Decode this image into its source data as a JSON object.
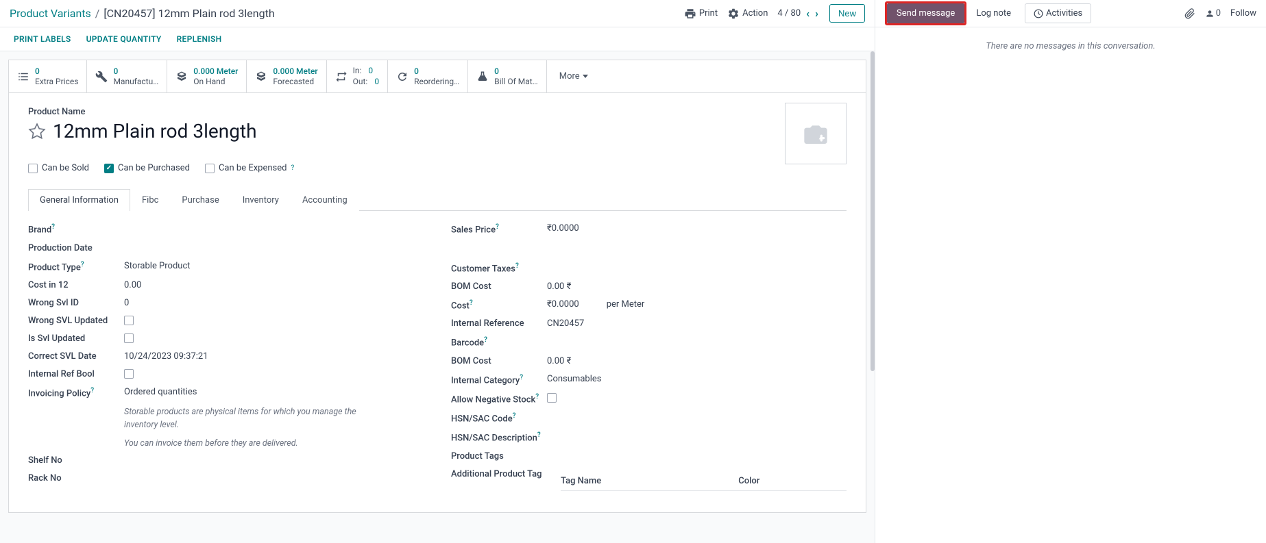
{
  "breadcrumb": {
    "root": "Product Variants",
    "current": "[CN20457] 12mm Plain rod 3length"
  },
  "topbar": {
    "print": "Print",
    "action": "Action",
    "pager": "4 / 80",
    "new": "New"
  },
  "subbar": {
    "print_labels": "PRINT LABELS",
    "update_qty": "UPDATE QUANTITY",
    "replenish": "REPLENISH"
  },
  "stats": {
    "extra_prices": {
      "val": "0",
      "lbl": "Extra Prices"
    },
    "manufacturing": {
      "val": "0",
      "lbl": "Manufactu…"
    },
    "on_hand": {
      "val": "0.000 Meter",
      "lbl": "On Hand"
    },
    "forecasted": {
      "val": "0.000 Meter",
      "lbl": "Forecasted"
    },
    "in_lbl": "In:",
    "in_val": "0",
    "out_lbl": "Out:",
    "out_val": "0",
    "reordering": {
      "val": "0",
      "lbl": "Reordering…"
    },
    "bom": {
      "val": "0",
      "lbl": "Bill Of Mat…"
    },
    "more": "More"
  },
  "product": {
    "name_label": "Product Name",
    "name": "12mm Plain rod 3length",
    "can_be_sold": "Can be Sold",
    "can_be_purchased": "Can be Purchased",
    "can_be_expensed": "Can be Expensed"
  },
  "tabs": {
    "general": "General Information",
    "fibc": "Fibc",
    "purchase": "Purchase",
    "inventory": "Inventory",
    "accounting": "Accounting"
  },
  "left_fields": {
    "brand": "Brand",
    "production_date": "Production Date",
    "product_type": "Product Type",
    "product_type_val": "Storable Product",
    "cost_in_12": "Cost in 12",
    "cost_in_12_val": "0.00",
    "wrong_svl_id": "Wrong Svl ID",
    "wrong_svl_id_val": "0",
    "wrong_svl_updated": "Wrong SVL Updated",
    "is_svl_updated": "Is Svl Updated",
    "correct_svl_date": "Correct SVL Date",
    "correct_svl_date_val": "10/24/2023 09:37:21",
    "internal_ref_bool": "Internal Ref Bool",
    "invoicing_policy": "Invoicing Policy",
    "invoicing_policy_val": "Ordered quantities",
    "note1": "Storable products are physical items for which you manage the inventory level.",
    "note2": "You can invoice them before they are delivered.",
    "shelf_no": "Shelf No",
    "rack_no": "Rack No"
  },
  "right_fields": {
    "sales_price": "Sales Price",
    "sales_price_val": "₹0.0000",
    "customer_taxes": "Customer Taxes",
    "bom_cost": "BOM Cost",
    "bom_cost_val": "0.00 ₹",
    "cost": "Cost",
    "cost_val": "₹0.0000",
    "cost_per": "per Meter",
    "internal_ref": "Internal Reference",
    "internal_ref_val": "CN20457",
    "barcode": "Barcode",
    "bom_cost2": "BOM Cost",
    "bom_cost2_val": "0.00 ₹",
    "internal_category": "Internal Category",
    "internal_category_val": "Consumables",
    "allow_negative": "Allow Negative Stock",
    "hsn_code": "HSN/SAC Code",
    "hsn_desc": "HSN/SAC Description",
    "product_tags": "Product Tags",
    "additional_tag": "Additional Product Tag",
    "tag_name_col": "Tag Name",
    "tag_color_col": "Color"
  },
  "chatter": {
    "send_message": "Send message",
    "log_note": "Log note",
    "activities": "Activities",
    "follow": "Follow",
    "follower_count": "0",
    "empty": "There are no messages in this conversation."
  }
}
